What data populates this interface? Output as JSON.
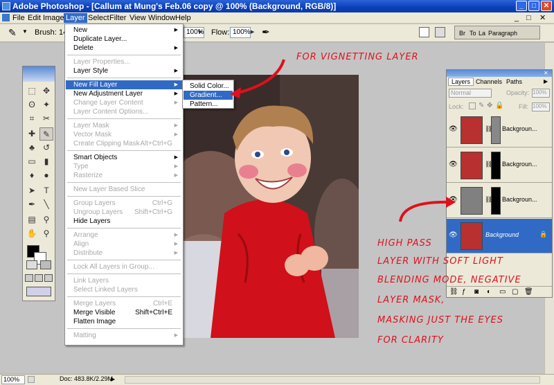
{
  "window": {
    "title": "Adobe Photoshop - [Callum at Mung's Feb.06 copy @ 100% (Background, RGB/8)]",
    "controls": [
      "_",
      "□",
      "✕"
    ]
  },
  "menubar": {
    "items": [
      "File",
      "Edit",
      "Image",
      "Layer",
      "Select",
      "Filter",
      "View",
      "Window",
      "Help"
    ],
    "active": "Layer",
    "doc_controls": [
      "_",
      "□",
      "✕"
    ]
  },
  "options_bar": {
    "brush_label": "Brush:",
    "brush_size": "14",
    "opacity_value": "100%",
    "flow_label": "Flow:",
    "flow_value": "100%",
    "palette_well": [
      "Br",
      "To",
      "La",
      "Paragraph"
    ]
  },
  "layer_menu": {
    "items": [
      {
        "label": "New",
        "arrow": true
      },
      {
        "label": "Duplicate Layer..."
      },
      {
        "label": "Delete",
        "arrow": true
      },
      {
        "sep": true
      },
      {
        "label": "Layer Properties...",
        "disabled": true
      },
      {
        "label": "Layer Style",
        "arrow": true
      },
      {
        "sep": true
      },
      {
        "label": "New Fill Layer",
        "arrow": true,
        "highlight": true
      },
      {
        "label": "New Adjustment Layer",
        "arrow": true
      },
      {
        "label": "Change Layer Content",
        "arrow": true,
        "disabled": true
      },
      {
        "label": "Layer Content Options...",
        "disabled": true
      },
      {
        "sep": true
      },
      {
        "label": "Layer Mask",
        "arrow": true,
        "disabled": true
      },
      {
        "label": "Vector Mask",
        "arrow": true,
        "disabled": true
      },
      {
        "label": "Create Clipping Mask",
        "shortcut": "Alt+Ctrl+G",
        "disabled": true
      },
      {
        "sep": true
      },
      {
        "label": "Smart Objects",
        "arrow": true
      },
      {
        "label": "Type",
        "arrow": true,
        "disabled": true
      },
      {
        "label": "Rasterize",
        "arrow": true,
        "disabled": true
      },
      {
        "sep": true
      },
      {
        "label": "New Layer Based Slice",
        "disabled": true
      },
      {
        "sep": true
      },
      {
        "label": "Group Layers",
        "shortcut": "Ctrl+G",
        "disabled": true
      },
      {
        "label": "Ungroup Layers",
        "shortcut": "Shift+Ctrl+G",
        "disabled": true
      },
      {
        "label": "Hide Layers"
      },
      {
        "sep": true
      },
      {
        "label": "Arrange",
        "arrow": true,
        "disabled": true
      },
      {
        "label": "Align",
        "arrow": true,
        "disabled": true
      },
      {
        "label": "Distribute",
        "arrow": true,
        "disabled": true
      },
      {
        "sep": true
      },
      {
        "label": "Lock All Layers in Group...",
        "disabled": true
      },
      {
        "sep": true
      },
      {
        "label": "Link Layers",
        "disabled": true
      },
      {
        "label": "Select Linked Layers",
        "disabled": true
      },
      {
        "sep": true
      },
      {
        "label": "Merge Layers",
        "shortcut": "Ctrl+E",
        "disabled": true
      },
      {
        "label": "Merge Visible",
        "shortcut": "Shift+Ctrl+E"
      },
      {
        "label": "Flatten Image"
      },
      {
        "sep": true
      },
      {
        "label": "Matting",
        "arrow": true,
        "disabled": true
      }
    ]
  },
  "fill_submenu": {
    "items": [
      {
        "label": "Solid Color..."
      },
      {
        "label": "Gradient...",
        "highlight": true
      },
      {
        "label": "Pattern..."
      }
    ]
  },
  "layers_panel": {
    "tabs": [
      "Layers",
      "Channels",
      "Paths"
    ],
    "blend_mode": "Normal",
    "opacity_label": "Opacity:",
    "opacity_value": "100%",
    "lock_label": "Lock:",
    "fill_label": "Fill:",
    "fill_value": "100%",
    "layers": [
      {
        "name": "Backgroun..."
      },
      {
        "name": "Backgroun..."
      },
      {
        "name": "Backgroun..."
      },
      {
        "name": "Background",
        "selected": true
      }
    ]
  },
  "annotations": {
    "vignetting": "FOR VIGNETTING LAYER",
    "high_pass": [
      "HIGH PASS",
      "LAYER WITH SOFT LIGHT",
      "BLENDING MODE, NEGATIVE",
      "LAYER MASK,",
      "MASKING JUST THE EYES",
      "FOR CLARITY"
    ]
  },
  "status_bar": {
    "zoom": "100%",
    "doc_info": "Doc: 483.8K/2.29M"
  },
  "colors": {
    "title_blue": "#0a3fb8",
    "menu_highlight": "#316ac5",
    "annotation_red": "#e0101c"
  }
}
